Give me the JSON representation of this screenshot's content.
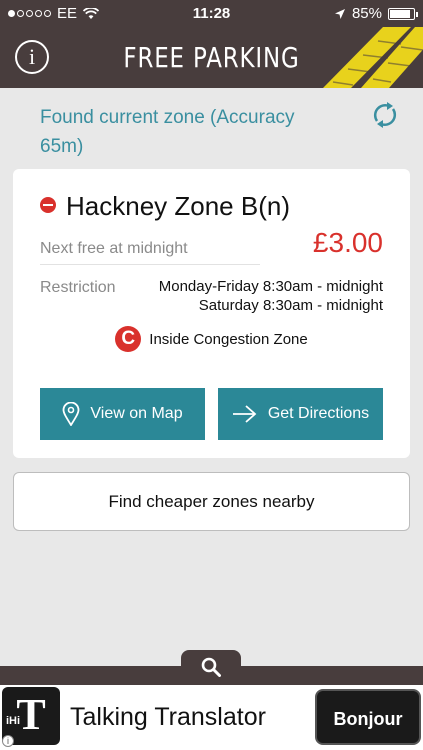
{
  "status_bar": {
    "carrier": "EE",
    "time": "11:28",
    "battery": "85%",
    "battery_level": 0.85
  },
  "header": {
    "title": "FREE PARKING",
    "info_icon": "info-icon"
  },
  "zone_detection": {
    "text": "Found current zone (Accuracy 65m)",
    "refresh_icon": "refresh-icon"
  },
  "zone_card": {
    "zone_name": "Hackney Zone B(n)",
    "next_free": "Next free at midnight",
    "price": "£3.00",
    "restriction_label": "Restriction",
    "restriction_lines": [
      "Monday-Friday 8:30am - midnight",
      "Saturday 8:30am - midnight"
    ],
    "congestion_text": "Inside Congestion Zone",
    "congestion_icon_letter": "C",
    "view_map_label": "View on Map",
    "directions_label": "Get Directions"
  },
  "find_cheaper_label": "Find cheaper zones nearby",
  "ad": {
    "logo_text": "T",
    "logo_small": "iHi",
    "text": "Talking Translator",
    "badge": "Bonjour"
  },
  "colors": {
    "bar": "#483d3d",
    "accent": "#2b8897",
    "price_red": "#d9312c",
    "stripe_yellow": "#e8d21c"
  }
}
